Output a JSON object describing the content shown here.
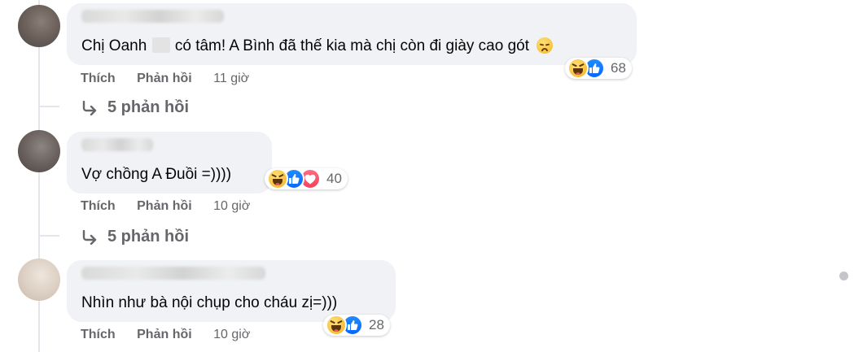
{
  "comments": [
    {
      "author": "",
      "text_before": "Chị Oanh",
      "text_after": "có tâm! A Bình đã thế kia mà chị còn đi giày cao gót",
      "reactions": [
        "haha",
        "like"
      ],
      "reaction_count": "68",
      "like_label": "Thích",
      "reply_label": "Phản hồi",
      "time": "11 giờ",
      "replies_label": "5 phản hồi"
    },
    {
      "author": "",
      "text": "Vợ chồng A Đuồi =))))",
      "reactions": [
        "haha",
        "like",
        "love"
      ],
      "reaction_count": "40",
      "like_label": "Thích",
      "reply_label": "Phản hồi",
      "time": "10 giờ",
      "replies_label": "5 phản hồi"
    },
    {
      "author": "",
      "text": "Nhìn như bà nội chụp cho cháu zị=)))",
      "reactions": [
        "haha",
        "like"
      ],
      "reaction_count": "28",
      "like_label": "Thích",
      "reply_label": "Phản hồi",
      "time": "10 giờ"
    }
  ],
  "colors": {
    "bubble": "#f0f2f5",
    "secondary_text": "#65676b",
    "like_blue": "#0866ff",
    "love_red": "#f3425f",
    "haha_yellow": "#f9c23c"
  },
  "icons": {
    "reply_arrow": "reply-arrow-icon",
    "sad_emoji": "disappointed-face-icon"
  }
}
